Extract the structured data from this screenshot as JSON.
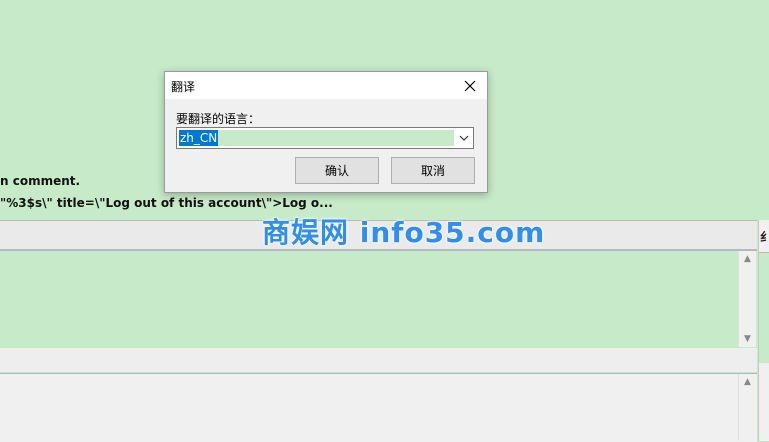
{
  "background": {
    "line1": "n comment.",
    "line2": "\"%3$s\\\" title=\\\"Log out of this account\\\">Log o...",
    "right_edge_glyph": "纟"
  },
  "watermark": "商娱网 info35.com",
  "dialog": {
    "title": "翻译",
    "prompt": "要翻译的语言：",
    "language_value": "zh_CN",
    "ok_label": "确认",
    "cancel_label": "取消"
  },
  "colors": {
    "editor_background": "#c7ebc9",
    "selection": "#0078d7",
    "watermark": "#2f8ef1"
  }
}
